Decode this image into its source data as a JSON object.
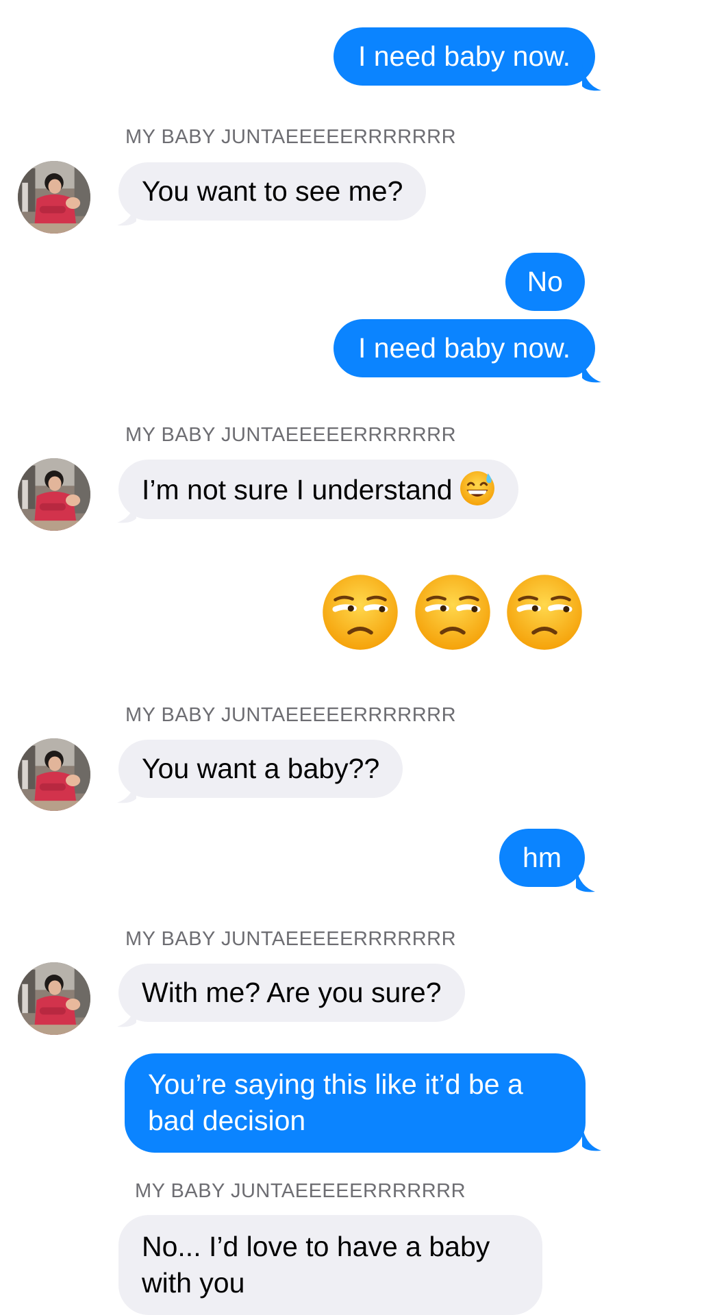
{
  "contact_name": "MY BABY JUNTAEEEEERRRRRRR",
  "colors": {
    "outgoing_bubble": "#0b84ff",
    "incoming_bubble": "#efeff4",
    "sender_label": "#6d6d72"
  },
  "avatar_icon": "contact-photo",
  "messages": [
    {
      "direction": "outgoing",
      "text": "I need baby now."
    },
    {
      "direction": "incoming",
      "sender": "MY BABY JUNTAEEEEERRRRRRR",
      "text": "You want to see me?"
    },
    {
      "direction": "outgoing",
      "text": "No"
    },
    {
      "direction": "outgoing",
      "text": "I need baby now."
    },
    {
      "direction": "incoming",
      "sender": "MY BABY JUNTAEEEEERRRRRRR",
      "text": "I’m not sure I understand",
      "emoji": "grinning-sweat-emoji"
    },
    {
      "direction": "outgoing",
      "emoji_only": [
        "unamused-face-emoji",
        "unamused-face-emoji",
        "unamused-face-emoji"
      ]
    },
    {
      "direction": "incoming",
      "sender": "MY BABY JUNTAEEEEERRRRRRR",
      "text": "You want a baby??"
    },
    {
      "direction": "outgoing",
      "text": "hm"
    },
    {
      "direction": "incoming",
      "sender": "MY BABY JUNTAEEEEERRRRRRR",
      "text": "With me? Are you sure?"
    },
    {
      "direction": "outgoing",
      "text": "You’re saying this like it’d be a bad decision"
    },
    {
      "direction": "incoming",
      "sender": "MY BABY JUNTAEEEEERRRRRRR",
      "text": "No... I’d love to have a baby with you"
    }
  ]
}
